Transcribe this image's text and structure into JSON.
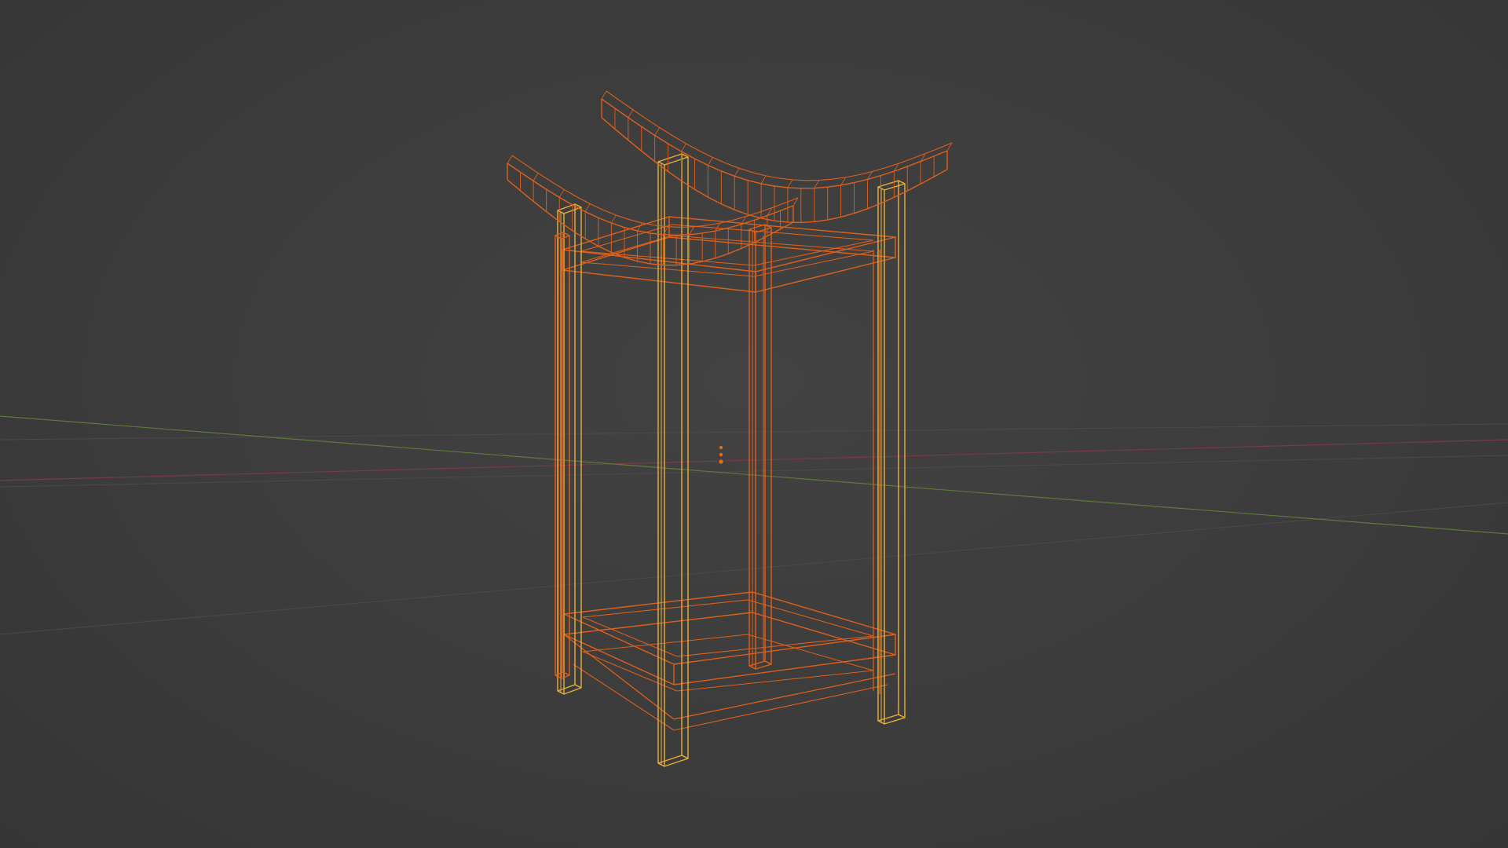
{
  "viewport": {
    "mode": "wireframe",
    "background": "#3d3d3d",
    "colors": {
      "axis_x": "#7a3a44",
      "axis_y": "#5d7a3a",
      "floor_grid": "#4a4a4a",
      "selected_wire": "#e0601a",
      "active_wire": "#e8b038",
      "origin_dot": "#e07018"
    }
  },
  "scene": {
    "object": "lantern-frame",
    "selected": true,
    "parts": [
      "roof-beam-back",
      "roof-beam-front",
      "top-frame",
      "bottom-frame",
      "post-front-left",
      "post-front-right",
      "post-back-left",
      "post-back-right",
      "post-center-front",
      "post-center-back"
    ]
  }
}
